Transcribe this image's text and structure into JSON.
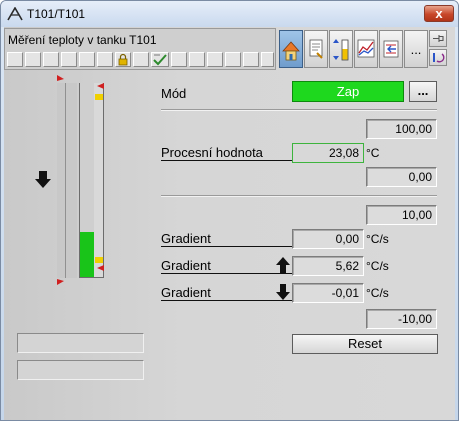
{
  "window": {
    "title": "T101/T101",
    "close_symbol": "x"
  },
  "header": {
    "title": "Měření teploty v tanku T101"
  },
  "toolbar": {
    "buttons": [
      {
        "name": "home-icon",
        "active": true
      },
      {
        "name": "notes-icon",
        "active": false
      },
      {
        "name": "limits-icon",
        "active": false
      },
      {
        "name": "trend-icon",
        "active": false
      },
      {
        "name": "messages-icon",
        "active": false
      },
      {
        "name": "more-icon",
        "active": false,
        "label": "..."
      }
    ]
  },
  "mode": {
    "label": "Mód",
    "value": "Zap",
    "value_color": "#1ed81e",
    "more_label": "..."
  },
  "process": {
    "top_limit": "100,00",
    "label": "Procesní hodnota",
    "value": "23,08",
    "unit": "°C",
    "bottom_limit": "0,00",
    "fill_fraction": 0.23,
    "fill_color": "#19c419"
  },
  "gradients": {
    "top_limit": "10,00",
    "rows": [
      {
        "label": "Gradient",
        "value": "0,00",
        "unit": "°C/s",
        "arrow": ""
      },
      {
        "label": "Gradient",
        "value": "5,62",
        "unit": "°C/s",
        "arrow": "up"
      },
      {
        "label": "Gradient",
        "value": "-0,01",
        "unit": "°C/s",
        "arrow": "down"
      }
    ],
    "bottom_limit": "-10,00"
  },
  "reset_label": "Reset"
}
